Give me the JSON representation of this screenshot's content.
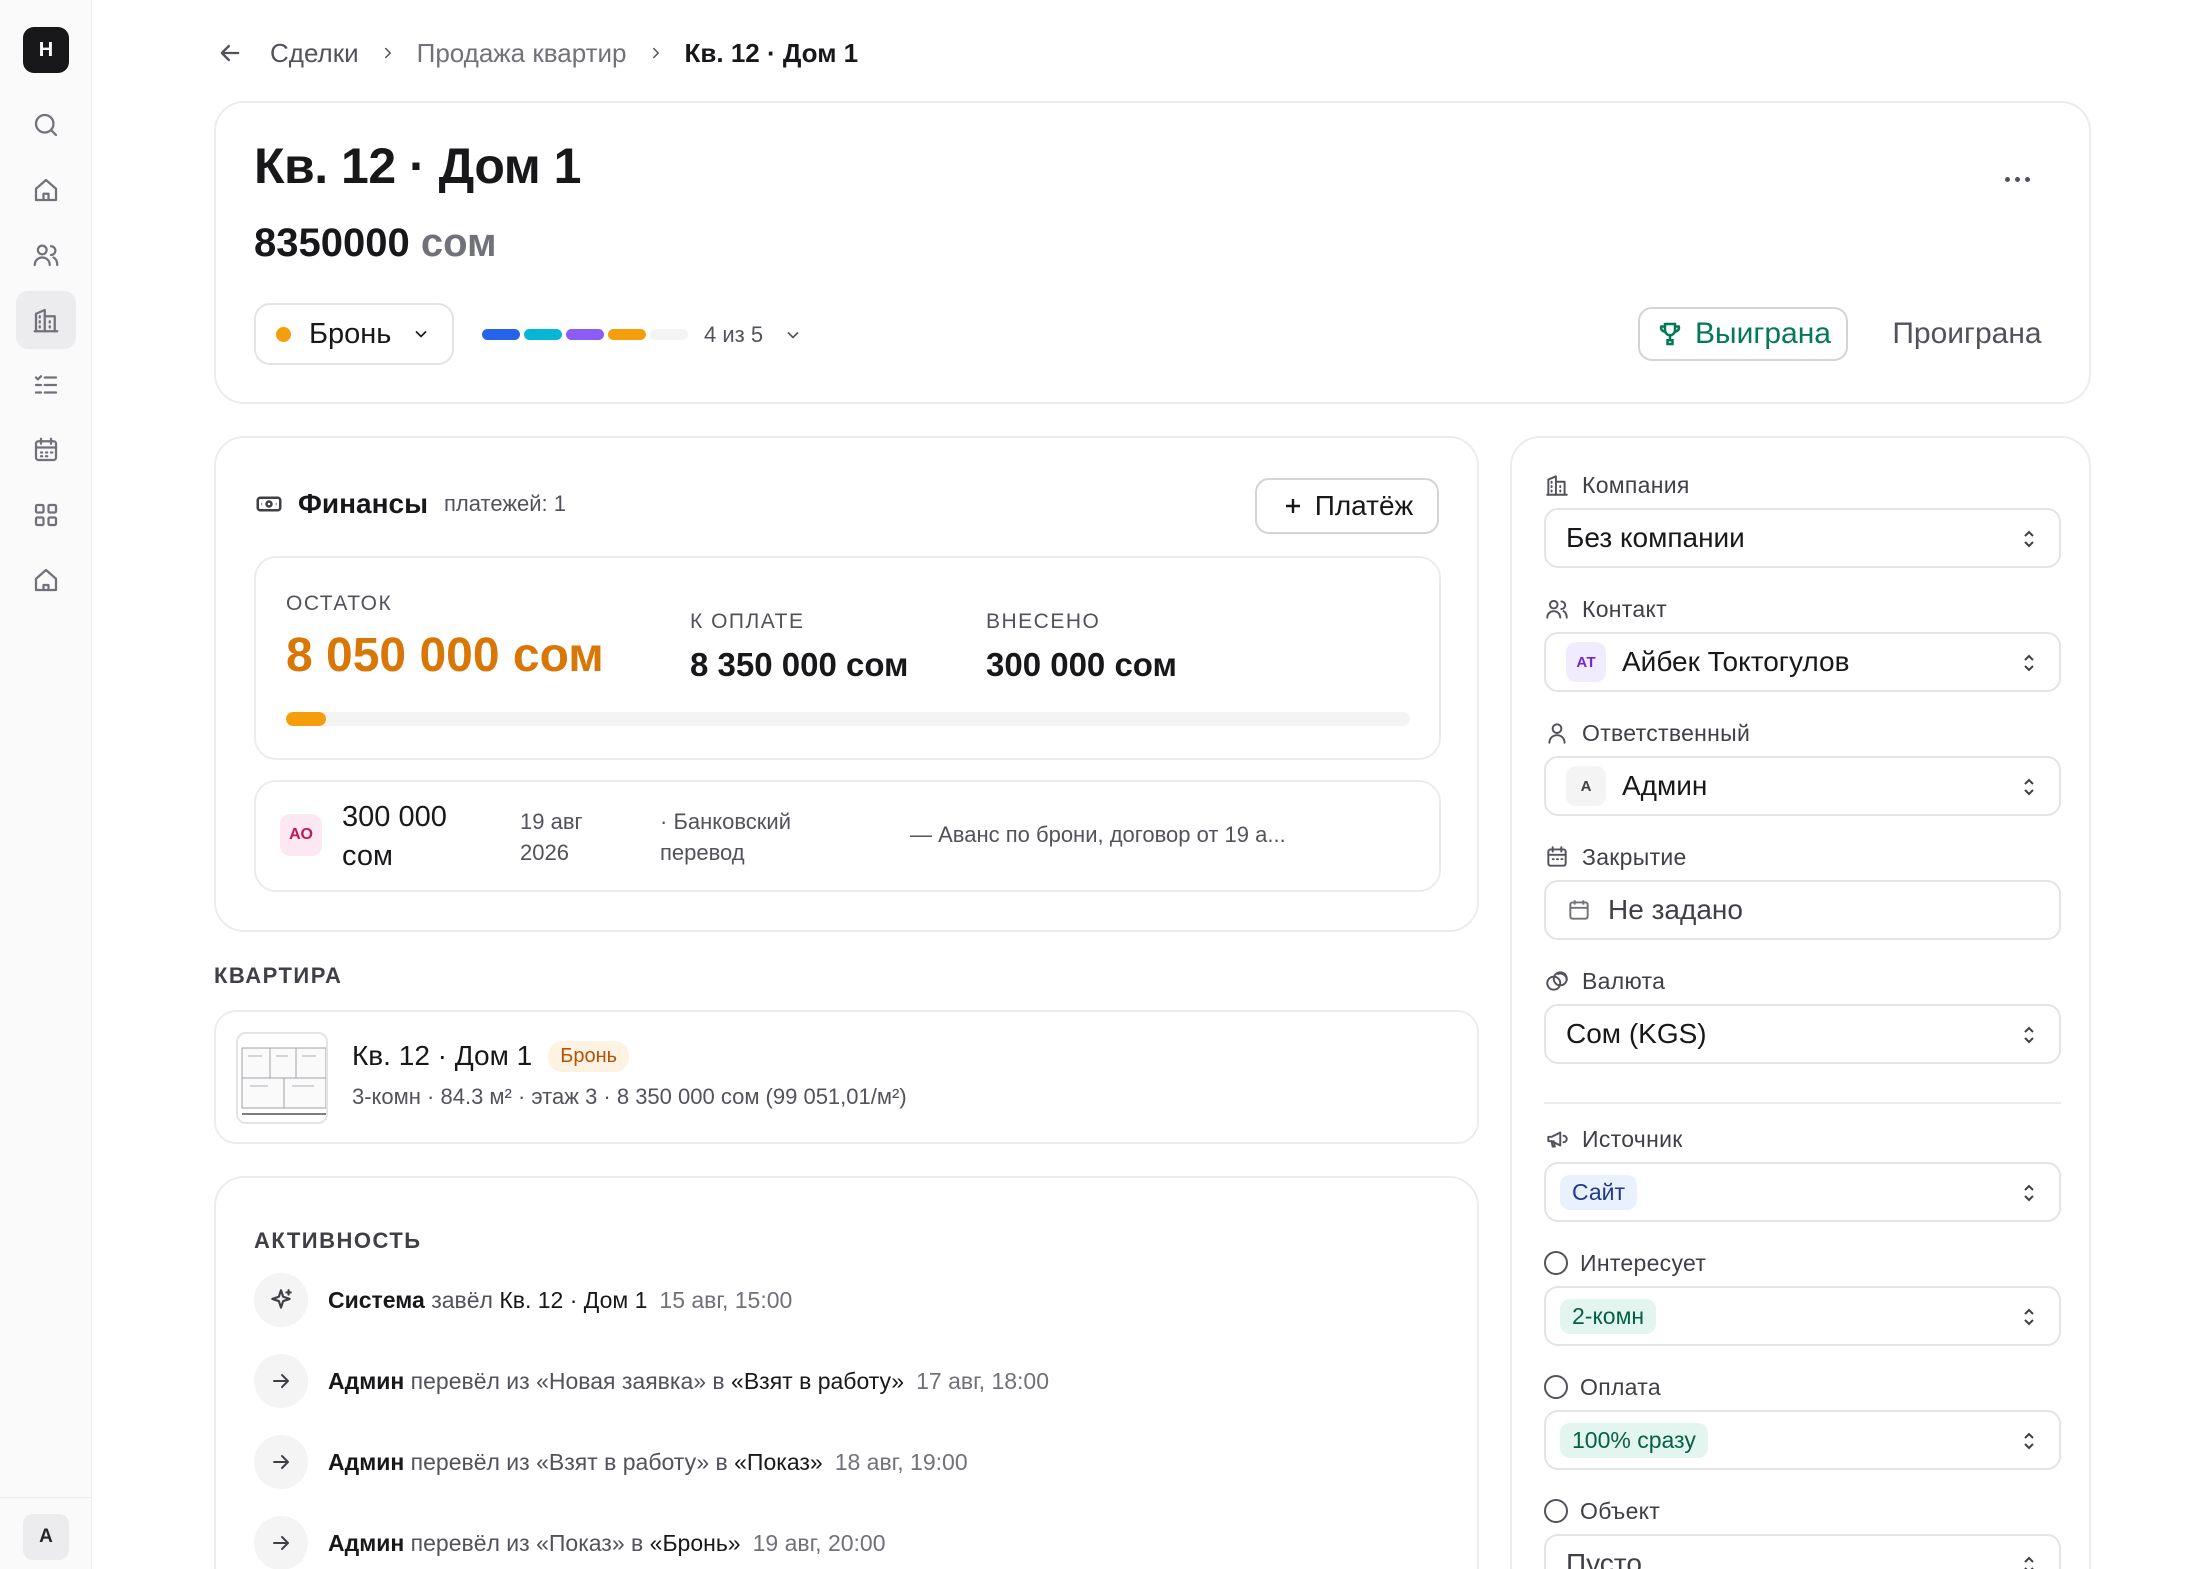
{
  "app": {
    "logo_letter": "H",
    "user_initial": "A"
  },
  "breadcrumb": {
    "items": [
      "Сделки",
      "Продажа квартир"
    ],
    "current": "Кв. 12 · Дом 1"
  },
  "deal": {
    "title": "Кв. 12 · Дом 1",
    "amount": "8350000",
    "currency": "сом",
    "stage": "Бронь",
    "stage_progress": "4 из 5",
    "stage_colors": [
      "#2563eb",
      "#06b6d4",
      "#8b5cf6",
      "#f59e0b",
      "#f4f4f5"
    ],
    "won_label": "Выиграна",
    "lost_label": "Проиграна"
  },
  "finance": {
    "title": "Финансы",
    "count": "платежей: 1",
    "add_payment": "Платёж",
    "balance_label": "ОСТАТОК",
    "balance": "8 050 000 сом",
    "due_label": "К ОПЛАТЕ",
    "due": "8 350 000 сом",
    "paid_label": "ВНЕСЕНО",
    "paid": "300 000 сом",
    "paid_fraction": 0.036,
    "payment": {
      "initials": "АО",
      "amount": "300 000 сом",
      "date": "19 авг 2026",
      "method": "· Банковский перевод",
      "note": "— Аванс по брони, договор от 19 а..."
    }
  },
  "apartment": {
    "section": "КВАРТИРА",
    "title": "Кв. 12 · Дом 1",
    "badge": "Бронь",
    "details": "3-комн · 84.3 м² · этаж 3 · 8 350 000 сом (99 051,01/м²)"
  },
  "activity": {
    "section": "АКТИВНОСТЬ",
    "rows": [
      {
        "actor": "Система",
        "action": "завёл",
        "target": "Кв. 12 · Дом 1",
        "time": "15 авг, 15:00"
      },
      {
        "actor": "Админ",
        "action": "перевёл из «Новая заявка» в",
        "target": "«Взят в работу»",
        "time": "17 авг, 18:00"
      },
      {
        "actor": "Админ",
        "action": "перевёл из «Взят в работу» в",
        "target": "«Показ»",
        "time": "18 авг, 19:00"
      },
      {
        "actor": "Админ",
        "action": "перевёл из «Показ» в",
        "target": "«Бронь»",
        "time": "19 авг, 20:00"
      }
    ]
  },
  "fields": {
    "company_label": "Компания",
    "company": "Без компании",
    "contact_label": "Контакт",
    "contact_initials": "АТ",
    "contact": "Айбек Токтогулов",
    "owner_label": "Ответственный",
    "owner_initial": "А",
    "owner": "Админ",
    "close_label": "Закрытие",
    "close": "Не задано",
    "currency_label": "Валюта",
    "currency": "Сом (KGS)",
    "source_label": "Источник",
    "source": "Сайт",
    "interest_label": "Интересует",
    "interest": "2-комн",
    "payment_label": "Оплата",
    "payment": "100% сразу",
    "object_label": "Объект",
    "object": "Пусто"
  },
  "colors": {
    "accent_orange": "#d97706",
    "won_green": "#047857"
  }
}
